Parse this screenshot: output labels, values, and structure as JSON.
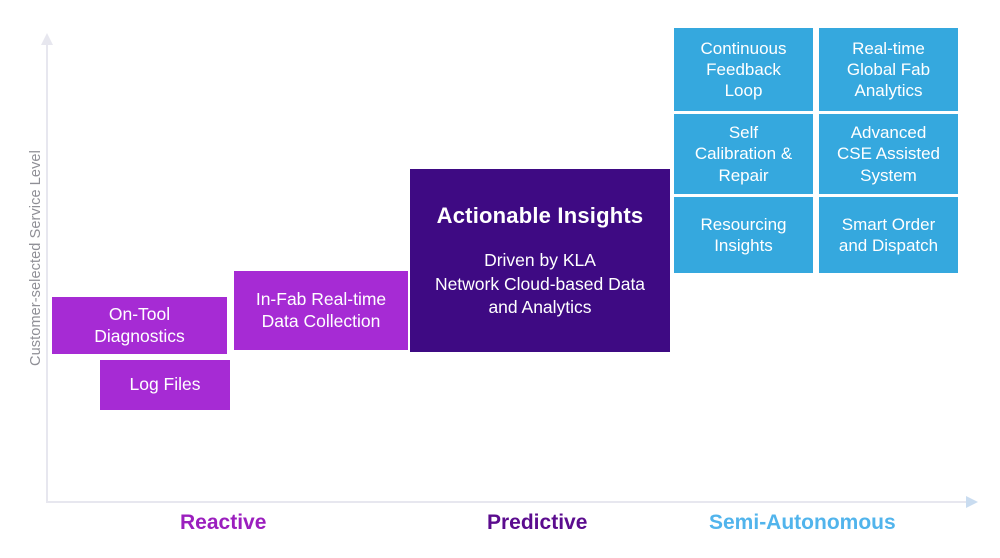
{
  "axes": {
    "y_label": "Customer-selected Service Level",
    "y_arrow_icon": "arrow-up-icon",
    "x_arrow_icon": "arrow-right-icon"
  },
  "stages": [
    {
      "key": "reactive",
      "label": "Reactive",
      "color": "#9b1fbe"
    },
    {
      "key": "predictive",
      "label": "Predictive",
      "color": "#5b0c8e"
    },
    {
      "key": "semi_autonomous",
      "label": "Semi-Autonomous",
      "color": "#51b4ec"
    }
  ],
  "reactive_boxes": [
    {
      "key": "on_tool_diagnostics",
      "line1": "On-Tool",
      "line2": "Diagnostics",
      "color": "#a62bd4"
    },
    {
      "key": "log_files",
      "line1": "Log Files",
      "line2": "",
      "color": "#a62bd4"
    },
    {
      "key": "in_fab_data",
      "line1": "In-Fab Real-time",
      "line2": "Data Collection",
      "color": "#a62bd4"
    }
  ],
  "actionable_insights": {
    "title": "Actionable Insights",
    "subtitle_line1": "Driven by KLA",
    "subtitle_line2": "Network Cloud-based Data",
    "subtitle_line3": "and Analytics",
    "color": "#3e0a83"
  },
  "semi_autonomous_boxes": [
    {
      "key": "continuous_feedback_loop",
      "line1": "Continuous",
      "line2": "Feedback",
      "line3": "Loop",
      "color": "#35a8de"
    },
    {
      "key": "real_time_global_fab_analytics",
      "line1": "Real-time",
      "line2": "Global Fab",
      "line3": "Analytics",
      "color": "#35a8de"
    },
    {
      "key": "self_calibration_repair",
      "line1": "Self",
      "line2": "Calibration &",
      "line3": "Repair",
      "color": "#35a8de"
    },
    {
      "key": "advanced_cse_assisted_system",
      "line1": "Advanced",
      "line2": "CSE Assisted",
      "line3": "System",
      "color": "#35a8de"
    },
    {
      "key": "resourcing_insights",
      "line1": "Resourcing",
      "line2": "Insights",
      "line3": "",
      "color": "#35a8de"
    },
    {
      "key": "smart_order_and_dispatch",
      "line1": "Smart Order",
      "line2": "and Dispatch",
      "line3": "",
      "color": "#35a8de"
    }
  ]
}
